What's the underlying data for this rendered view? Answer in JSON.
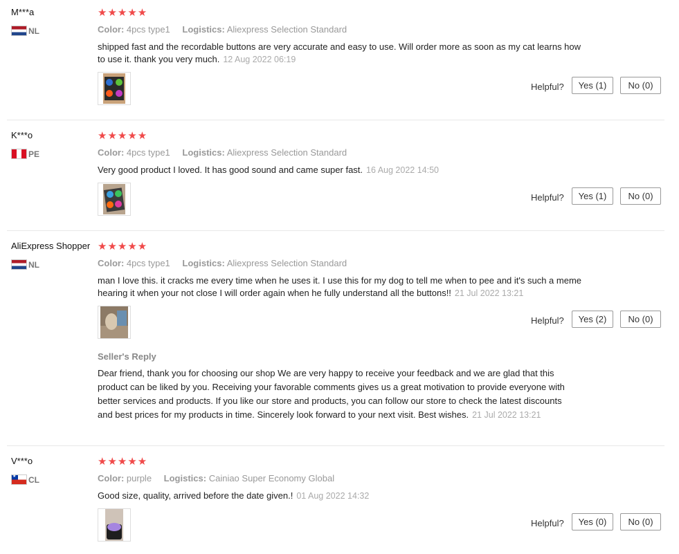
{
  "helpful_label": "Helpful?",
  "meta_labels": {
    "color": "Color:",
    "logistics": "Logistics:"
  },
  "reviews": [
    {
      "user": "M***a",
      "country": "NL",
      "stars": "★★★★★",
      "color": "4pcs type1",
      "logistics": "Aliexpress Selection Standard",
      "text": "shipped fast and the recordable buttons are very accurate and easy to use. Will order more as soon as my cat learns how to use it. thank you very much.",
      "date": "12 Aug 2022 06:19",
      "yes": "Yes (1)",
      "no": "No (0)"
    },
    {
      "user": "K***o",
      "country": "PE",
      "stars": "★★★★★",
      "color": "4pcs type1",
      "logistics": "Aliexpress Selection Standard",
      "text": "Very good product I loved. It has good sound and came super fast.",
      "date": "16 Aug 2022 14:50",
      "yes": "Yes (1)",
      "no": "No (0)"
    },
    {
      "user": "AliExpress Shopper",
      "country": "NL",
      "stars": "★★★★★",
      "color": "4pcs type1",
      "logistics": "Aliexpress Selection Standard",
      "text": "man I love this. it cracks me every time when he uses it. I use this for my dog to tell me when to pee and it's such a meme hearing it when your not close I will order again when he fully understand all the buttons!!",
      "date": "21 Jul 2022 13:21",
      "yes": "Yes (2)",
      "no": "No (0)",
      "reply_title": "Seller's Reply",
      "reply_text": "Dear friend, thank you for choosing our shop We are very happy to receive your feedback and we are glad that this product can be liked by you. Receiving your favorable comments gives us a great motivation to provide everyone with better services and products. If you like our store and products, you can follow our store to check the latest discounts and best prices for my products in time. Sincerely look forward to your next visit. Best wishes.",
      "reply_date": "21 Jul 2022 13:21"
    },
    {
      "user": "V***o",
      "country": "CL",
      "stars": "★★★★★",
      "color": "purple",
      "logistics": "Cainiao Super Economy Global",
      "text": "Good size, quality, arrived before the date given.!",
      "date": "01 Aug 2022 14:32",
      "yes": "Yes (0)",
      "no": "No (0)"
    }
  ]
}
